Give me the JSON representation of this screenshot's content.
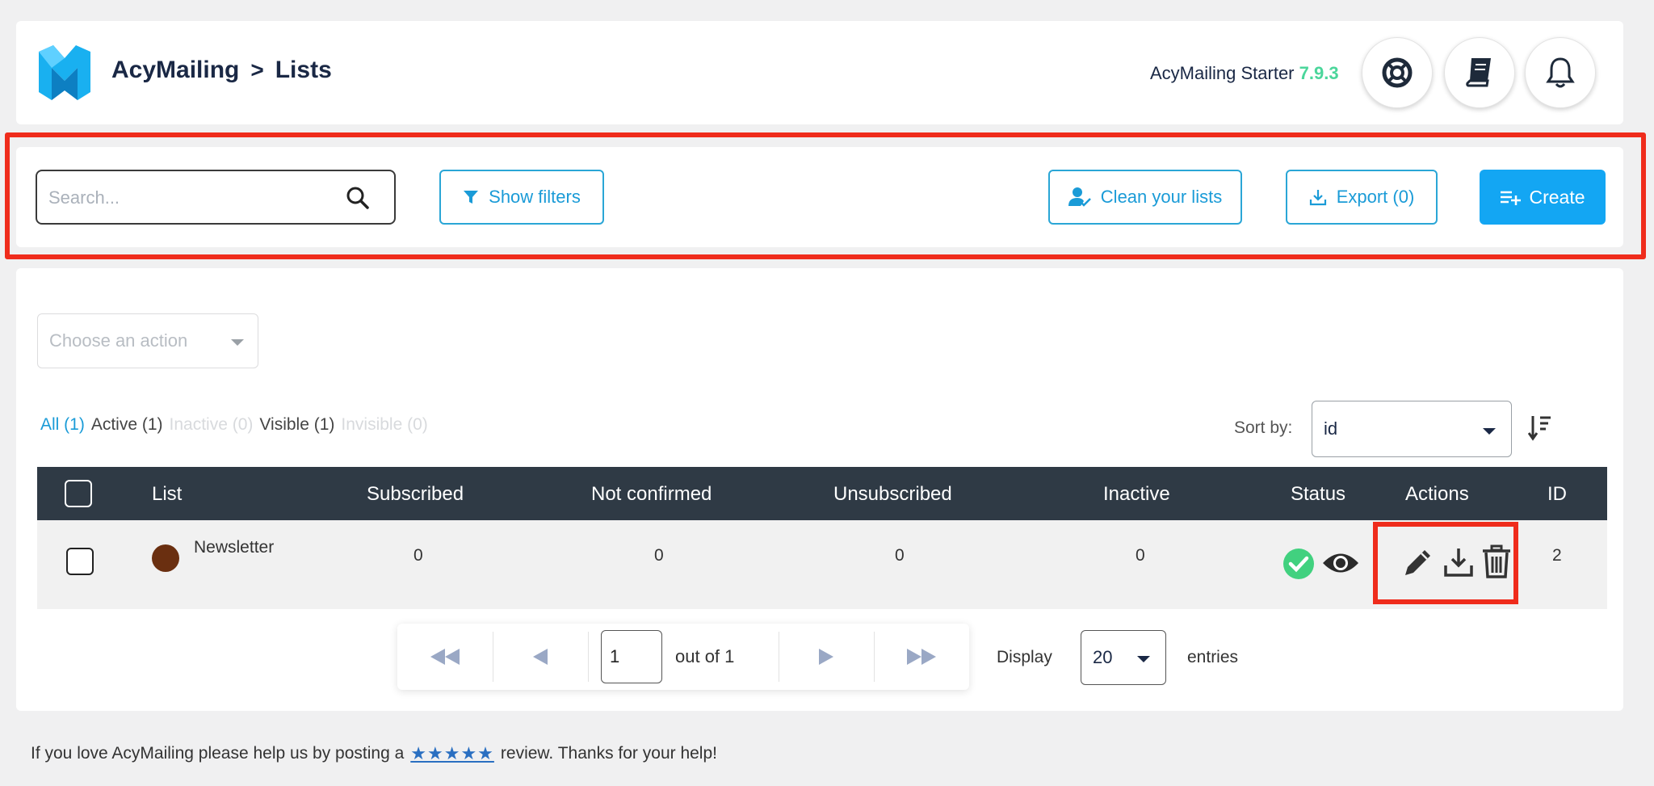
{
  "header": {
    "app_name": "AcyMailing",
    "separator": ">",
    "page_name": "Lists",
    "version_label": "AcyMailing Starter",
    "version_number": "7.9.3",
    "buttons": [
      {
        "icon": "lifebuoy-icon"
      },
      {
        "icon": "book-icon"
      },
      {
        "icon": "bell-icon"
      }
    ],
    "brand_color": "#1da1f2"
  },
  "toolbar": {
    "search_placeholder": "Search...",
    "show_filters_label": "Show filters",
    "clean_lists_label": "Clean your lists",
    "export_label": "Export (0)",
    "create_label": "Create"
  },
  "main": {
    "action_placeholder": "Choose an action",
    "status_filters": [
      {
        "label": "All (1)",
        "state": "current"
      },
      {
        "label": "Active (1)",
        "state": "normal"
      },
      {
        "label": "Inactive (0)",
        "state": "muted"
      },
      {
        "label": "Visible (1)",
        "state": "normal"
      },
      {
        "label": "Invisible (0)",
        "state": "muted"
      }
    ],
    "sort_label": "Sort by:",
    "sort_value": "id",
    "table": {
      "columns": [
        "List",
        "Subscribed",
        "Not confirmed",
        "Unsubscribed",
        "Inactive",
        "Status",
        "Actions",
        "ID"
      ],
      "rows": [
        {
          "name": "Newsletter",
          "color": "#6a2f10",
          "subscribed": "0",
          "not_confirmed": "0",
          "unsubscribed": "0",
          "inactive": "0",
          "status_icons": [
            "check-circle-icon",
            "eye-icon"
          ],
          "action_icons": [
            "pencil-icon",
            "download-icon",
            "trash-icon"
          ],
          "id": "2"
        }
      ]
    },
    "pagination": {
      "current_page": "1",
      "out_of_label": "out of 1",
      "display_label": "Display",
      "per_page": "20",
      "entries_label": "entries"
    }
  },
  "footer": {
    "text_before": "If you love AcyMailing please help us by posting a",
    "stars": "★★★★★",
    "text_after": "review. Thanks for your help!"
  },
  "colors": {
    "accent": "#1a9bd7",
    "create_button": "#13a6f3",
    "table_header": "#2f3a45",
    "status_green": "#41d17f",
    "highlight_red": "#ef2c1c"
  }
}
